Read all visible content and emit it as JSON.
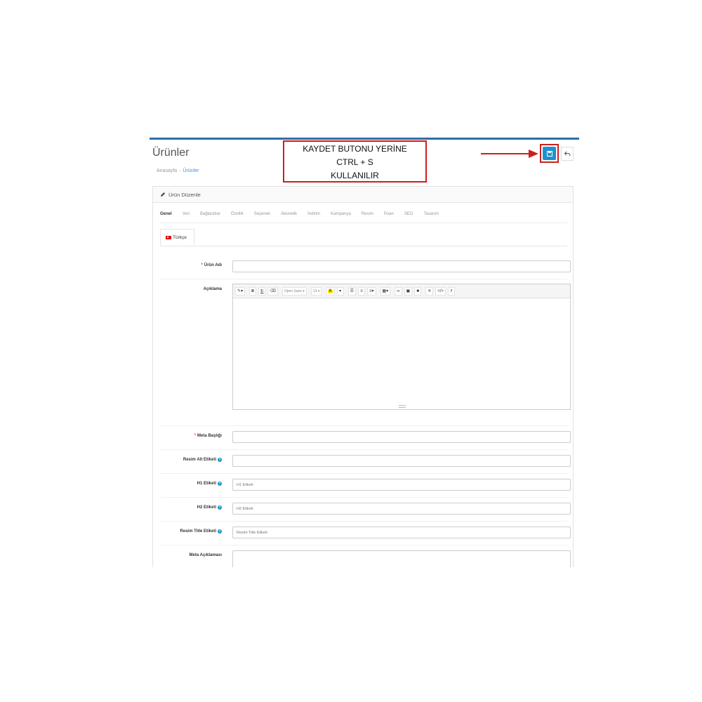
{
  "page": {
    "title": "Ürünler",
    "breadcrumb": [
      "Anasayfa",
      "Ürünler"
    ]
  },
  "annotation": {
    "lines": [
      "KAYDET BUTONU YERİNE",
      "CTRL + S",
      "KULLANILIR"
    ],
    "color": "#cc1f1f"
  },
  "actions": {
    "save_icon": "save-icon",
    "back_icon": "reply-icon",
    "save_color": "#1e91cf"
  },
  "panel": {
    "heading": "Ürün Düzenle",
    "heading_icon": "pencil-icon"
  },
  "tabs": [
    "Genel",
    "Veri",
    "Bağlantılar",
    "Özellik",
    "Seçenek",
    "Abonelik",
    "İndirim",
    "Kampanya",
    "Resim",
    "Puan",
    "SEO",
    "Tasarım"
  ],
  "active_tab": "Genel",
  "language_tab": "Türkçe",
  "form": {
    "product_name": {
      "label": "Ürün Adı",
      "required": true,
      "value": "",
      "placeholder": ""
    },
    "description": {
      "label": "Açıklama"
    },
    "meta_title": {
      "label": "Meta Başlığı",
      "required": true,
      "value": "",
      "placeholder": ""
    },
    "image_alt": {
      "label": "Resim Alt Etiketi",
      "help": true,
      "value": "",
      "placeholder": ""
    },
    "h1": {
      "label": "H1 Etiketi",
      "help": true,
      "value": "",
      "placeholder": "H1 Etiketi"
    },
    "h2": {
      "label": "H2 Etiketi",
      "help": true,
      "value": "",
      "placeholder": "H2 Etiketi"
    },
    "image_title": {
      "label": "Resim Title Etiketi",
      "help": true,
      "value": "",
      "placeholder": "Resim Title Etiketi"
    },
    "meta_description": {
      "label": "Meta Açıklaması"
    }
  },
  "editor_toolbar": {
    "font_name": "Open Sans",
    "font_size": "13",
    "buttons": [
      "magic-icon",
      "bold-icon",
      "underline-icon",
      "eraser-icon",
      "font-family-select",
      "font-size-select",
      "color-icon",
      "unordered-list-icon",
      "ordered-list-icon",
      "paragraph-icon",
      "table-icon",
      "link-icon",
      "picture-icon",
      "video-icon",
      "fullscreen-icon",
      "code-view-icon",
      "help-icon"
    ],
    "bold": "B",
    "underline": "U",
    "color_letter": "A",
    "help": "?",
    "code": "</>"
  }
}
